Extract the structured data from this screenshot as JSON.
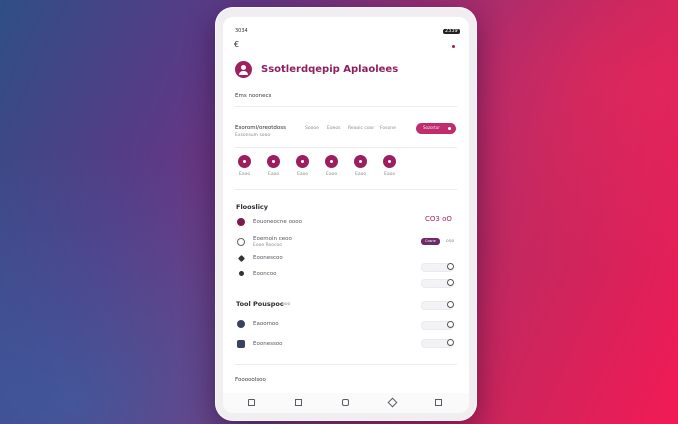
{
  "status": {
    "time": "3034",
    "battery": "2339"
  },
  "header": {
    "back_icon": "chevron-left-icon",
    "menu_icon": "dot-menu-icon",
    "title": "Ssotlerdqepip Aplaolees",
    "subtitle": "Ems noonecs"
  },
  "settings": {
    "label": "Esoromi/oreotdoss",
    "sublabel": "Exsonsum sooo",
    "options": [
      "Soooe",
      "Eoeos",
      "Reaoic coor",
      "Fosone"
    ],
    "action_label": "Sozortor"
  },
  "quick_actions": [
    {
      "label": "Eaoo"
    },
    {
      "label": "Eaoo"
    },
    {
      "label": "Eaoo"
    },
    {
      "label": "Eaoo"
    },
    {
      "label": "Eaoo"
    },
    {
      "label": "Eaoo"
    }
  ],
  "section1": {
    "title": "Flooslicy",
    "items": [
      {
        "label": "Eouoneocne oooo",
        "control_text": "CO3 oO"
      },
      {
        "label": "Eoemoin ceoo",
        "sublabel": "Eooe Roocoo",
        "button": "Cosne",
        "extra": "ooo"
      },
      {
        "label": "Eoonescoo"
      },
      {
        "label": "Eooncoo"
      }
    ]
  },
  "section2": {
    "title": "Tool Pouspoc",
    "badge": "ooo",
    "items": [
      {
        "label": "Eaoomoo"
      },
      {
        "label": "Eoonessoo"
      }
    ]
  },
  "footer": {
    "label": "Fooooolsoo"
  },
  "bottom_nav": [
    "bookmark-icon",
    "square-icon",
    "home-icon",
    "diamond-icon",
    "square-icon"
  ],
  "colors": {
    "accent": "#9b1f5e",
    "accent_light": "#c8327a",
    "chip_dark": "#6f2a6a"
  }
}
